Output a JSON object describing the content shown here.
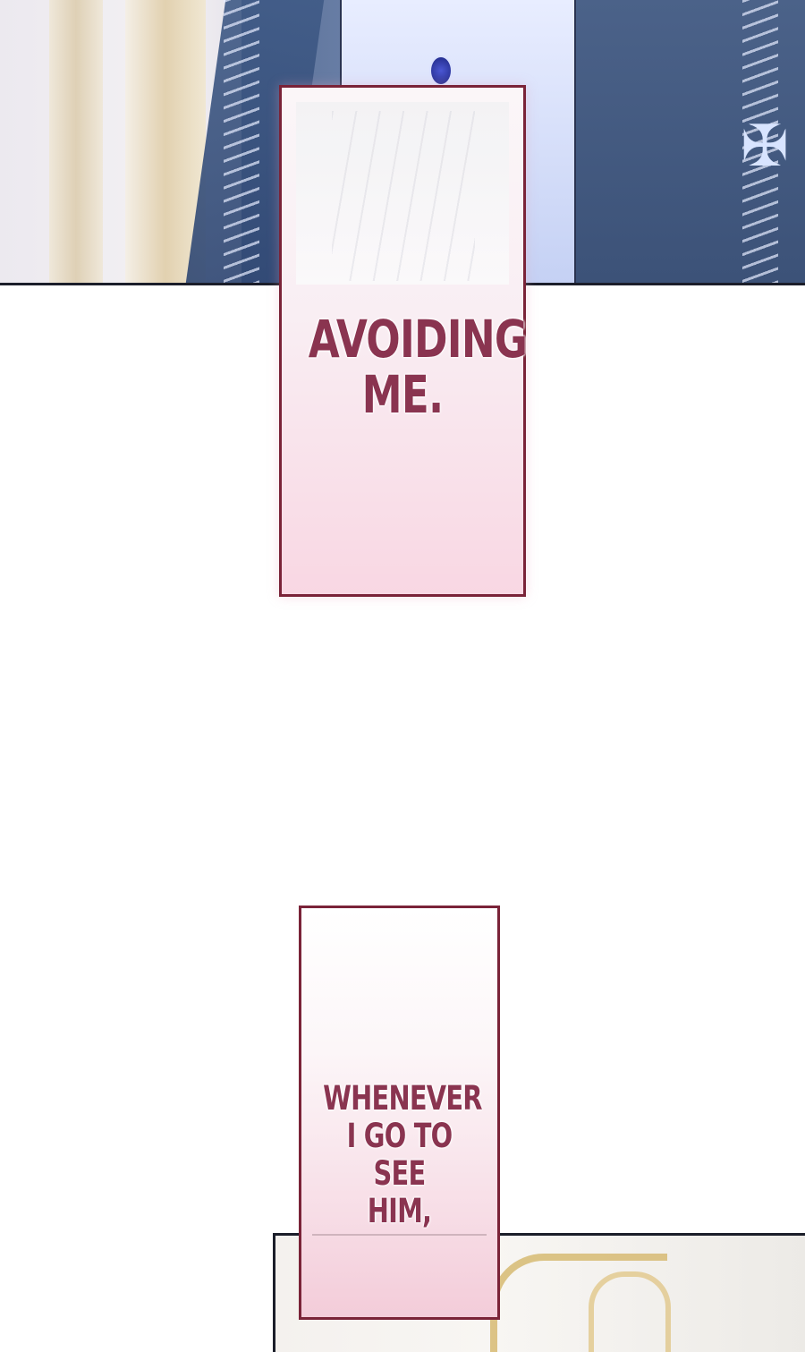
{
  "captions": [
    {
      "lines": [
        "AVOIDING",
        "ME."
      ]
    },
    {
      "lines": [
        "WHENEVER",
        "I GO TO SEE",
        "HIM,"
      ]
    }
  ],
  "colors": {
    "caption_border": "#7a2338",
    "caption_text": "#8a3450",
    "caption_fill_pink": "#f9d7e3",
    "robe_blue": "#4b6289"
  }
}
